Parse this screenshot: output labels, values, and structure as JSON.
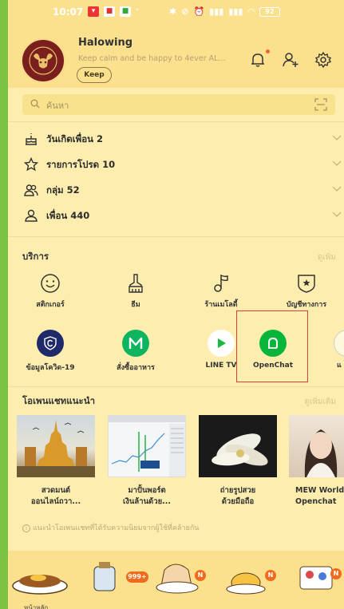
{
  "status_bar": {
    "time": "10:07",
    "battery": "92"
  },
  "profile": {
    "name": "Halowing",
    "status_message": "Keep calm and be happy to 4ever AL...",
    "keep_label": "Keep"
  },
  "search": {
    "placeholder": "ค้นหา"
  },
  "friends_list": [
    {
      "label": "วันเกิดเพื่อน 2",
      "icon": "cake-icon"
    },
    {
      "label": "รายการโปรด 10",
      "icon": "star-icon"
    },
    {
      "label": "กลุ่ม 52",
      "icon": "group-icon"
    },
    {
      "label": "เพื่อน 440",
      "icon": "person-icon"
    }
  ],
  "services": {
    "title": "บริการ",
    "more_label": "ดูเพิ่ม",
    "row1": [
      {
        "label": "สติกเกอร์",
        "icon": "sticker-smile-icon"
      },
      {
        "label": "ธีม",
        "icon": "brush-icon"
      },
      {
        "label": "ร้านเมโลดี้",
        "icon": "music-note-icon"
      },
      {
        "label": "บัญชีทางการ",
        "icon": "official-account-icon"
      }
    ],
    "row2": [
      {
        "label": "ข้อมูลโควิด-19",
        "icon": "covid-shield-icon",
        "color": "#1f2a6b"
      },
      {
        "label": "สั่งซื้ออาหาร",
        "icon": "line-man-icon",
        "color": "#0fb45e"
      },
      {
        "label": "LINE TV",
        "icon": "line-tv-play-icon",
        "color": "#ffffff"
      },
      {
        "label": "OpenChat",
        "icon": "openchat-icon",
        "color": "#07b53b"
      }
    ]
  },
  "openchat_recommend": {
    "title": "โอเพนแชทแนะนำ",
    "more_label": "ดูเพิ่มเติม",
    "items": [
      {
        "title_line1": "สวดมนต์",
        "title_line2": "ออนไลน์ถวา..."
      },
      {
        "title_line1": "มาปั้นพอร์ต",
        "title_line2": "เงินล้านด้วย..."
      },
      {
        "title_line1": "ถ่ายรูปสวย",
        "title_line2": "ด้วยมือถือ"
      },
      {
        "title_line1": "MEW World",
        "title_line2": "Openchat"
      }
    ],
    "note": "แนะนำโอเพนแชทที่ได้รับความนิยมจากผู้ใช้ที่คล้ายกัน"
  },
  "tab_bar": {
    "home_label": "หน้าหลัก",
    "badge_count": "999+",
    "badge_n1": "N",
    "badge_n2": "N",
    "badge_n3": "N"
  },
  "colors": {
    "background": "#fdeeb0",
    "header": "#fbe08e",
    "highlight_box": "#e23b3b",
    "line_green": "#07b53b"
  }
}
